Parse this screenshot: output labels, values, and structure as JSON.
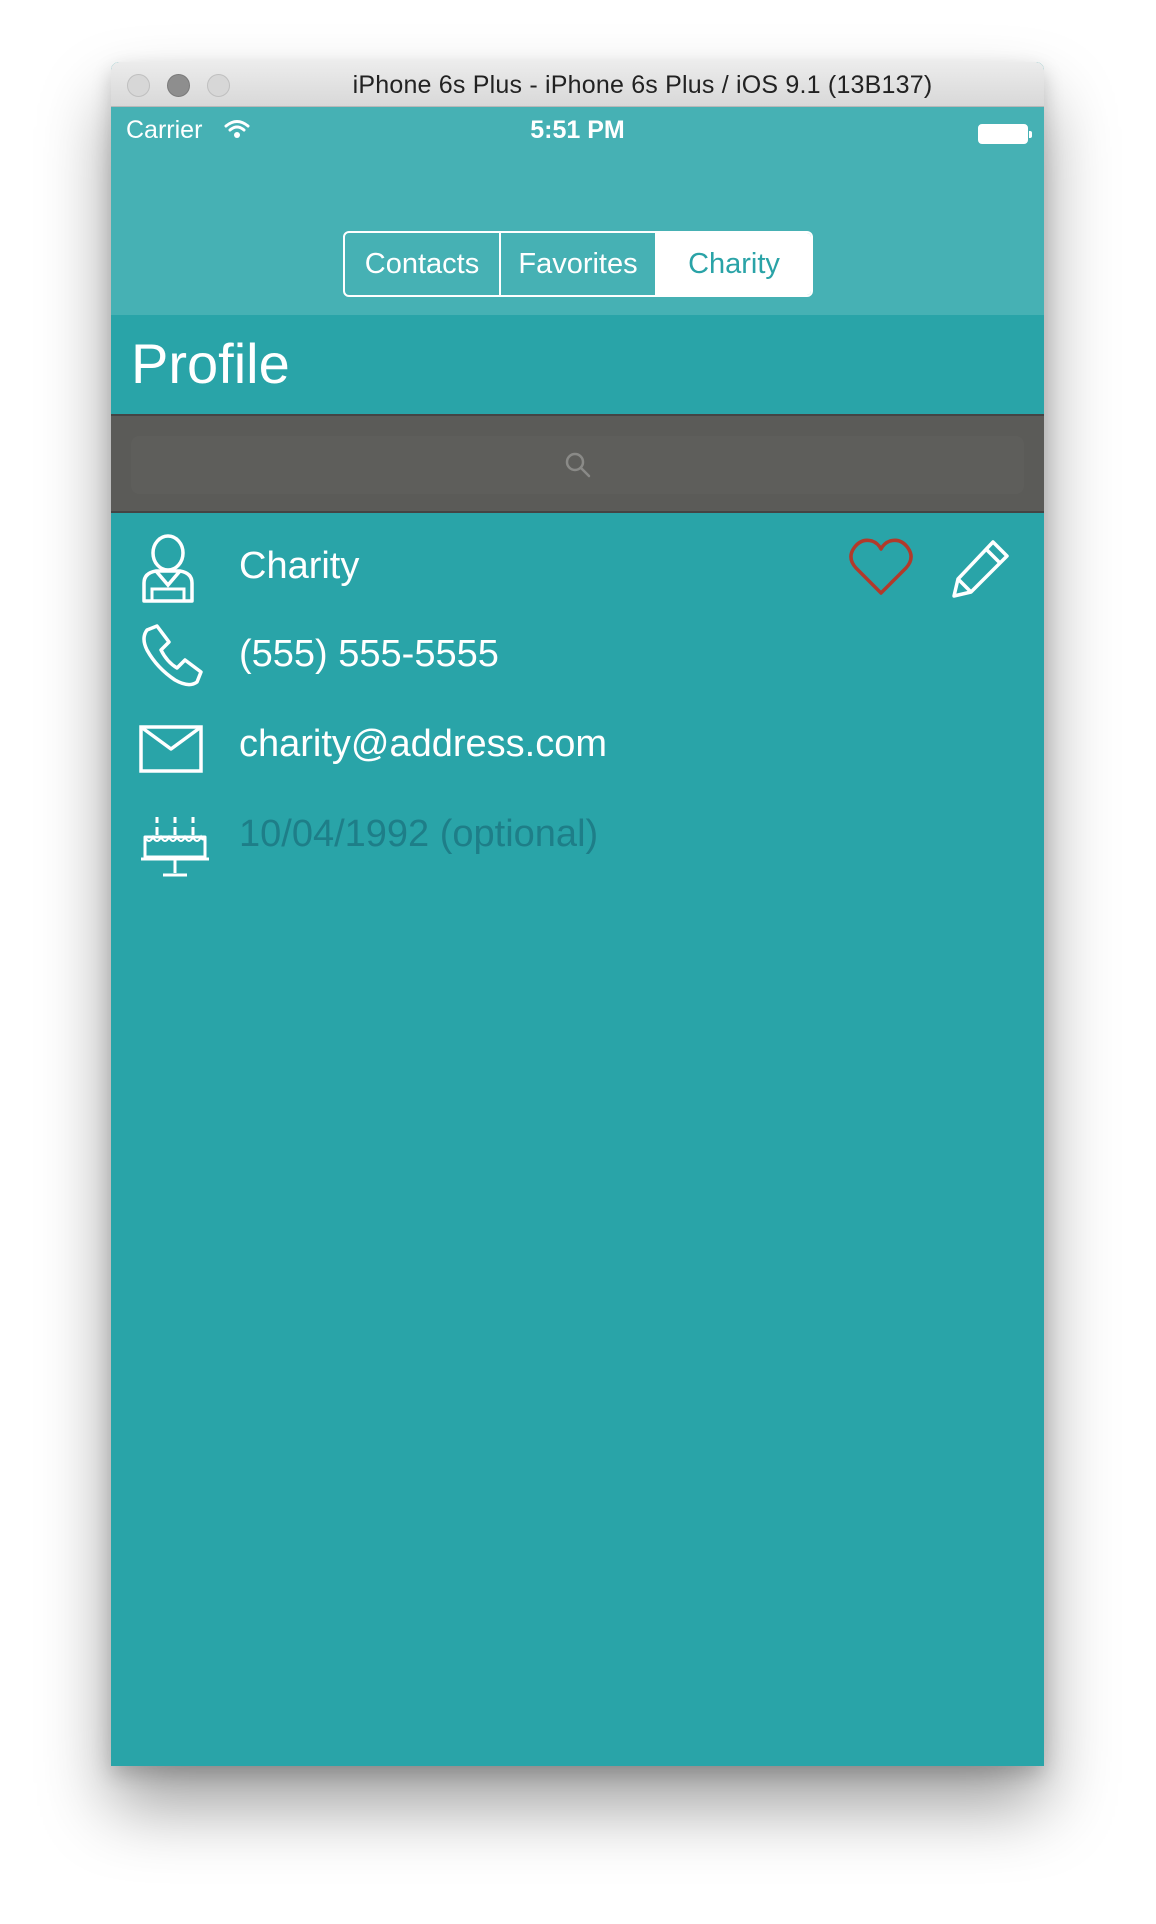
{
  "window": {
    "title": "iPhone 6s Plus - iPhone 6s Plus / iOS 9.1 (13B137)"
  },
  "status_bar": {
    "carrier": "Carrier",
    "time": "5:51 PM"
  },
  "segments": {
    "items": [
      "Contacts",
      "Favorites",
      "Charity"
    ],
    "selected": "Charity"
  },
  "page": {
    "title": "Profile"
  },
  "profile": {
    "name": "Charity",
    "phone": "(555) 555-5555",
    "email": "charity@address.com",
    "birthday_placeholder": "10/04/1992 (optional)"
  },
  "colors": {
    "accent": "#29a4a8",
    "nav_background": "#46b1b4",
    "favorite_heart": "#b23a2b",
    "search_background": "#5b5b58"
  },
  "icons": {
    "person": "person-icon",
    "phone": "phone-icon",
    "email": "envelope-icon",
    "birthday": "cake-icon",
    "favorite": "heart-icon",
    "edit": "pencil-icon",
    "search": "search-icon"
  }
}
